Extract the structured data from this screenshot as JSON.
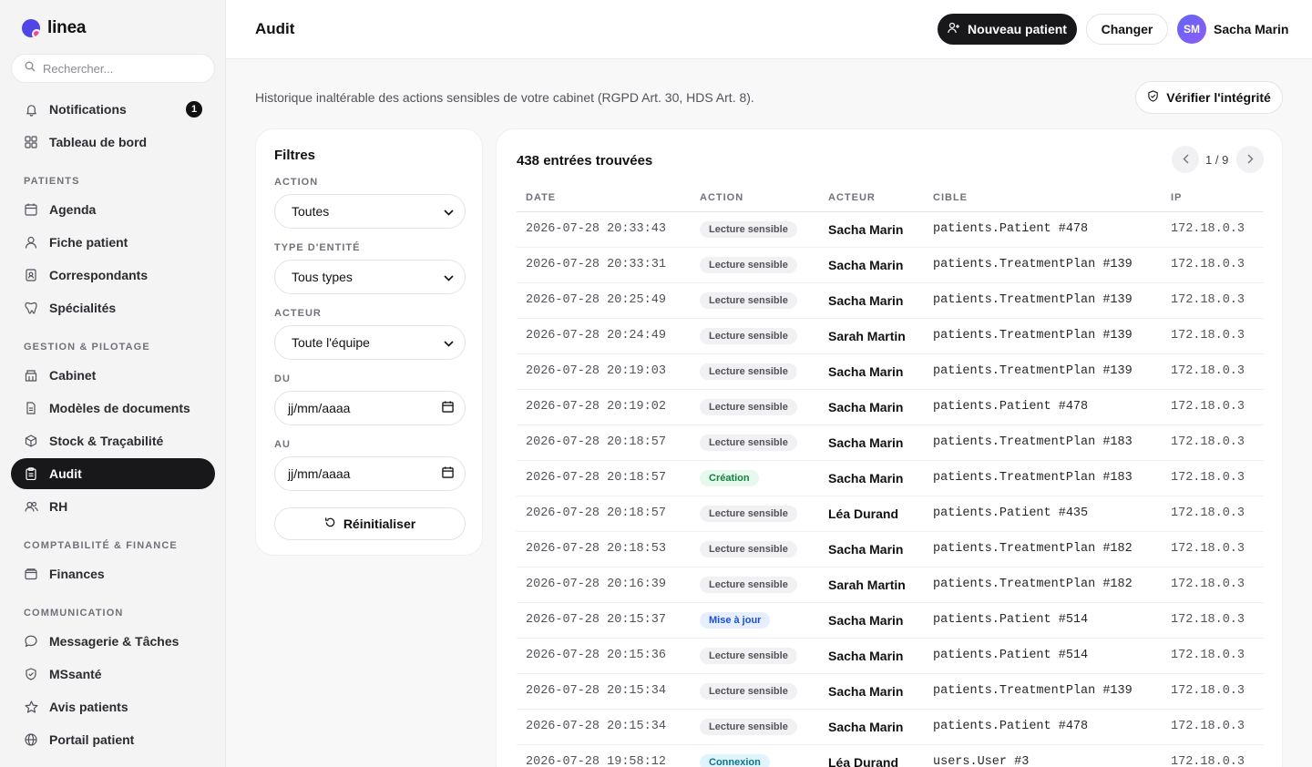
{
  "app": {
    "brand": "linea"
  },
  "search": {
    "placeholder": "Rechercher..."
  },
  "sidebar": {
    "top_items": [
      {
        "label": "Notifications",
        "icon": "bell-icon",
        "badge": "1"
      },
      {
        "label": "Tableau de bord",
        "icon": "grid-icon"
      }
    ],
    "sections": [
      {
        "title": "PATIENTS",
        "items": [
          {
            "label": "Agenda",
            "icon": "calendar-icon"
          },
          {
            "label": "Fiche patient",
            "icon": "user-icon"
          },
          {
            "label": "Correspondants",
            "icon": "contact-card-icon"
          },
          {
            "label": "Spécialités",
            "icon": "tooth-icon"
          }
        ]
      },
      {
        "title": "GESTION & PILOTAGE",
        "items": [
          {
            "label": "Cabinet",
            "icon": "building-icon"
          },
          {
            "label": "Modèles de documents",
            "icon": "document-icon"
          },
          {
            "label": "Stock & Traçabilité",
            "icon": "box-icon"
          },
          {
            "label": "Audit",
            "icon": "clipboard-icon",
            "active": true
          },
          {
            "label": "RH",
            "icon": "users-icon"
          }
        ]
      },
      {
        "title": "COMPTABILITÉ & FINANCE",
        "items": [
          {
            "label": "Finances",
            "icon": "wallet-icon"
          }
        ]
      },
      {
        "title": "COMMUNICATION",
        "items": [
          {
            "label": "Messagerie & Tâches",
            "icon": "chat-icon"
          },
          {
            "label": "MSsanté",
            "icon": "shield-icon"
          },
          {
            "label": "Avis patients",
            "icon": "star-icon"
          },
          {
            "label": "Portail patient",
            "icon": "globe-icon"
          }
        ]
      }
    ]
  },
  "header": {
    "title": "Audit",
    "new_patient": "Nouveau patient",
    "change": "Changer",
    "avatar_initials": "SM",
    "user_name": "Sacha Marin"
  },
  "main": {
    "subtitle": "Historique inaltérable des actions sensibles de votre cabinet (RGPD Art. 30, HDS Art. 8).",
    "verify_button": "Vérifier l'intégrité"
  },
  "filters": {
    "title": "Filtres",
    "action_label": "ACTION",
    "action_value": "Toutes",
    "entity_label": "TYPE D'ENTITÉ",
    "entity_value": "Tous types",
    "actor_label": "ACTEUR",
    "actor_value": "Toute l'équipe",
    "from_label": "DU",
    "from_value": "jj/mm/aaaa",
    "to_label": "AU",
    "to_value": "jj/mm/aaaa",
    "reset": "Réinitialiser"
  },
  "results": {
    "count": "438 entrées trouvées",
    "page": "1 / 9",
    "columns": [
      "DATE",
      "ACTION",
      "ACTEUR",
      "CIBLE",
      "IP"
    ],
    "rows": [
      {
        "date": "2026-07-28 20:33:43",
        "action": "Lecture sensible",
        "kind": "read",
        "actor": "Sacha Marin",
        "target": "patients.Patient #478",
        "ip": "172.18.0.3"
      },
      {
        "date": "2026-07-28 20:33:31",
        "action": "Lecture sensible",
        "kind": "read",
        "actor": "Sacha Marin",
        "target": "patients.TreatmentPlan #139",
        "ip": "172.18.0.3"
      },
      {
        "date": "2026-07-28 20:25:49",
        "action": "Lecture sensible",
        "kind": "read",
        "actor": "Sacha Marin",
        "target": "patients.TreatmentPlan #139",
        "ip": "172.18.0.3"
      },
      {
        "date": "2026-07-28 20:24:49",
        "action": "Lecture sensible",
        "kind": "read",
        "actor": "Sarah Martin",
        "target": "patients.TreatmentPlan #139",
        "ip": "172.18.0.3"
      },
      {
        "date": "2026-07-28 20:19:03",
        "action": "Lecture sensible",
        "kind": "read",
        "actor": "Sacha Marin",
        "target": "patients.TreatmentPlan #139",
        "ip": "172.18.0.3"
      },
      {
        "date": "2026-07-28 20:19:02",
        "action": "Lecture sensible",
        "kind": "read",
        "actor": "Sacha Marin",
        "target": "patients.Patient #478",
        "ip": "172.18.0.3"
      },
      {
        "date": "2026-07-28 20:18:57",
        "action": "Lecture sensible",
        "kind": "read",
        "actor": "Sacha Marin",
        "target": "patients.TreatmentPlan #183",
        "ip": "172.18.0.3"
      },
      {
        "date": "2026-07-28 20:18:57",
        "action": "Création",
        "kind": "create",
        "actor": "Sacha Marin",
        "target": "patients.TreatmentPlan #183",
        "ip": "172.18.0.3"
      },
      {
        "date": "2026-07-28 20:18:57",
        "action": "Lecture sensible",
        "kind": "read",
        "actor": "Léa Durand",
        "target": "patients.Patient #435",
        "ip": "172.18.0.3"
      },
      {
        "date": "2026-07-28 20:18:53",
        "action": "Lecture sensible",
        "kind": "read",
        "actor": "Sacha Marin",
        "target": "patients.TreatmentPlan #182",
        "ip": "172.18.0.3"
      },
      {
        "date": "2026-07-28 20:16:39",
        "action": "Lecture sensible",
        "kind": "read",
        "actor": "Sarah Martin",
        "target": "patients.TreatmentPlan #182",
        "ip": "172.18.0.3"
      },
      {
        "date": "2026-07-28 20:15:37",
        "action": "Mise à jour",
        "kind": "update",
        "actor": "Sacha Marin",
        "target": "patients.Patient #514",
        "ip": "172.18.0.3"
      },
      {
        "date": "2026-07-28 20:15:36",
        "action": "Lecture sensible",
        "kind": "read",
        "actor": "Sacha Marin",
        "target": "patients.Patient #514",
        "ip": "172.18.0.3"
      },
      {
        "date": "2026-07-28 20:15:34",
        "action": "Lecture sensible",
        "kind": "read",
        "actor": "Sacha Marin",
        "target": "patients.TreatmentPlan #139",
        "ip": "172.18.0.3"
      },
      {
        "date": "2026-07-28 20:15:34",
        "action": "Lecture sensible",
        "kind": "read",
        "actor": "Sacha Marin",
        "target": "patients.Patient #478",
        "ip": "172.18.0.3"
      },
      {
        "date": "2026-07-28 19:58:12",
        "action": "Connexion",
        "kind": "login",
        "actor": "Léa Durand",
        "target": "users.User #3",
        "ip": "172.18.0.3"
      }
    ]
  }
}
